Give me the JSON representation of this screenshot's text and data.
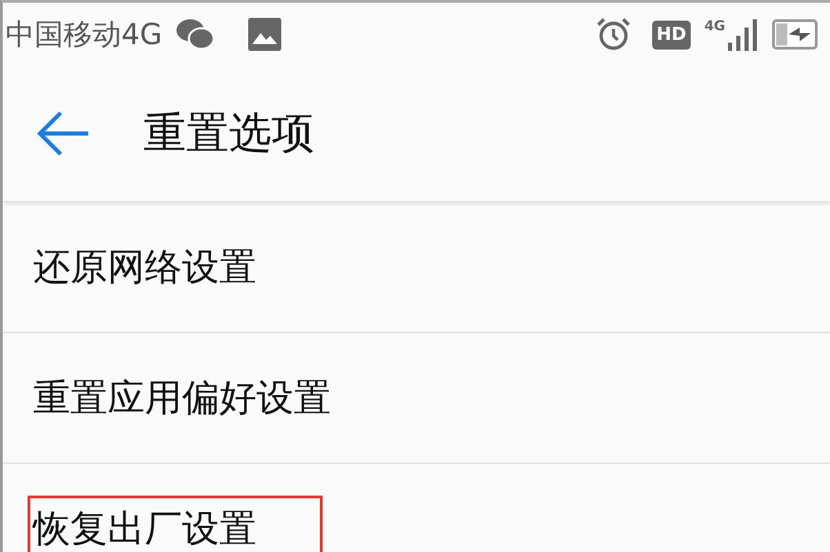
{
  "status_bar": {
    "carrier": "中国移动4G",
    "hd_badge": "HD",
    "network_type": "4G"
  },
  "header": {
    "title": "重置选项"
  },
  "items": [
    {
      "label": "还原网络设置",
      "highlighted": false
    },
    {
      "label": "重置应用偏好设置",
      "highlighted": false
    },
    {
      "label": "恢复出厂设置",
      "highlighted": true
    }
  ]
}
